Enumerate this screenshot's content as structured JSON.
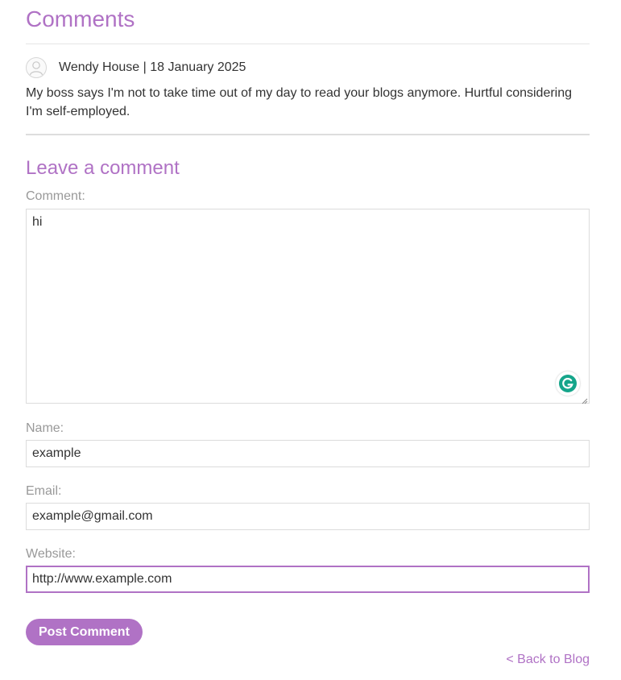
{
  "comments_section": {
    "title": "Comments",
    "items": [
      {
        "author_date": "Wendy House | 18 January 2025",
        "text": "My boss says I'm not to take time out of my day to read your blogs anymore. Hurtful considering I'm self-employed.",
        "avatar_icon": "user-avatar-icon"
      }
    ]
  },
  "form": {
    "title": "Leave a comment",
    "comment": {
      "label": "Comment:",
      "value": "hi"
    },
    "name": {
      "label": "Name:",
      "value": "example"
    },
    "email": {
      "label": "Email:",
      "value": "example@gmail.com"
    },
    "website": {
      "label": "Website:",
      "value": "http://www.example.com"
    },
    "submit_label": "Post Comment",
    "extension_icon": "grammarly-icon"
  },
  "back_link": "< Back to Blog",
  "colors": {
    "accent": "#b072c5",
    "label": "#999999",
    "text": "#333333",
    "border": "#dcdcdc",
    "grammarly": "#15a58a"
  }
}
